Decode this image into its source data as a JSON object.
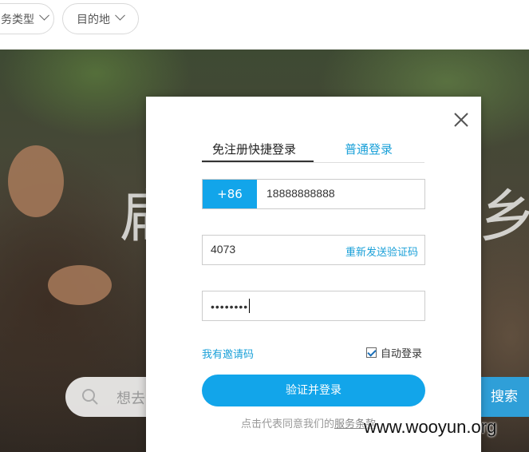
{
  "filters": {
    "type_label": "务类型",
    "destination_label": "目的地"
  },
  "hero": {
    "title_left": "扁",
    "title_right": "乡",
    "search_placeholder": "想去",
    "search_button": "搜索"
  },
  "login_modal": {
    "tabs": [
      {
        "label": "免注册快捷登录",
        "active": true
      },
      {
        "label": "普通登录",
        "active": false
      }
    ],
    "phone": {
      "country_code": "+86",
      "value": "18888888888"
    },
    "verification": {
      "value": "4073",
      "resend_label": "重新发送验证码"
    },
    "password": {
      "masked_value": "••••••••"
    },
    "invite_link": "我有邀请码",
    "auto_login": {
      "label": "自动登录",
      "checked": true
    },
    "submit_label": "验证并登录",
    "terms_prefix": "点击代表同意我们的",
    "terms_link": "服务条款"
  },
  "watermark": "www.wooyun.org",
  "colors": {
    "accent": "#12a5ea",
    "link": "#1aa0d8"
  }
}
